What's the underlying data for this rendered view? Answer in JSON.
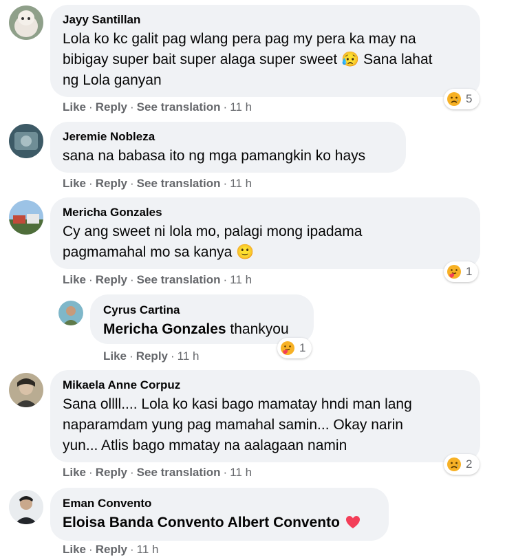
{
  "comments": [
    {
      "author": "Jayy Santillan",
      "lines": [
        "Lola ko kc galit pag wlang pera pag my pera ka may na",
        "bibigay super bait super alaga super sweet 😥 Sana lahat",
        "ng Lola ganyan"
      ],
      "actions": {
        "like": "Like",
        "reply": "Reply",
        "translate": "See translation",
        "time": "11 h"
      },
      "reaction_count": "5"
    },
    {
      "author": "Jeremie Nobleza",
      "lines": [
        "sana na babasa ito ng mga pamangkin ko hays"
      ],
      "actions": {
        "like": "Like",
        "reply": "Reply",
        "translate": "See translation",
        "time": "11 h"
      }
    },
    {
      "author": "Mericha Gonzales",
      "lines": [
        "Cy ang sweet ni lola mo, palagi mong ipadama",
        "pagmamahal mo sa kanya 🙂"
      ],
      "actions": {
        "like": "Like",
        "reply": "Reply",
        "translate": "See translation",
        "time": "11 h"
      },
      "reaction_count": "1"
    },
    {
      "author": "Cyrus Cartina",
      "mention": "Mericha Gonzales",
      "text_after_mention": " thankyou",
      "actions": {
        "like": "Like",
        "reply": "Reply",
        "time": "11 h"
      },
      "reaction_count": "1"
    },
    {
      "author": "Mikaela Anne Corpuz",
      "lines": [
        "Sana ollll.... Lola ko kasi bago mamatay hndi man lang",
        "naparamdam yung pag mamahal samin... Okay narin",
        "yun... Atlis bago mmatay na aalagaan namin"
      ],
      "actions": {
        "like": "Like",
        "reply": "Reply",
        "translate": "See translation",
        "time": "11 h"
      },
      "reaction_count": "2"
    },
    {
      "author": "Eman Convento",
      "mention": "Eloisa Banda Convento Albert Convento",
      "actions": {
        "like": "Like",
        "reply": "Reply",
        "time": "11 h"
      }
    }
  ],
  "separator": "·",
  "colors": {
    "bubble": "#f0f2f5",
    "meta": "#65676b",
    "text": "#050505",
    "heart": "#f33e58",
    "emoji": "#f7b125"
  }
}
